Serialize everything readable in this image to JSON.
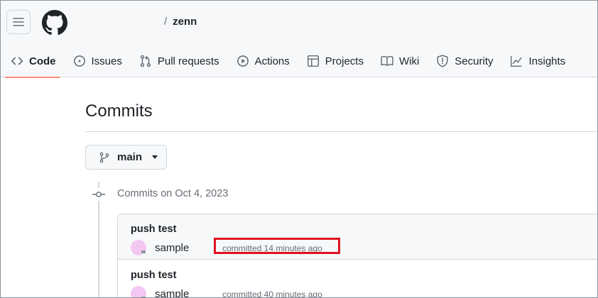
{
  "repo": {
    "separator": "/",
    "name": "zenn"
  },
  "tabs": [
    {
      "label": "Code",
      "icon": "code-icon"
    },
    {
      "label": "Issues",
      "icon": "issue-opened-icon"
    },
    {
      "label": "Pull requests",
      "icon": "git-pull-request-icon"
    },
    {
      "label": "Actions",
      "icon": "play-icon"
    },
    {
      "label": "Projects",
      "icon": "table-icon"
    },
    {
      "label": "Wiki",
      "icon": "book-icon"
    },
    {
      "label": "Security",
      "icon": "shield-icon"
    },
    {
      "label": "Insights",
      "icon": "graph-icon"
    }
  ],
  "page": {
    "title": "Commits"
  },
  "branch": {
    "label": "main"
  },
  "group": {
    "date_label": "Commits on Oct 4, 2023"
  },
  "commits": [
    {
      "message": "push test",
      "author": "sample",
      "time": "committed 14 minutes ago"
    },
    {
      "message": "push test",
      "author": "sample",
      "time": "committed 40 minutes ago"
    }
  ],
  "colors": {
    "active_tab_underline": "#fd8c73",
    "highlight": "#e0121f",
    "avatar": "#f4c6f2"
  }
}
